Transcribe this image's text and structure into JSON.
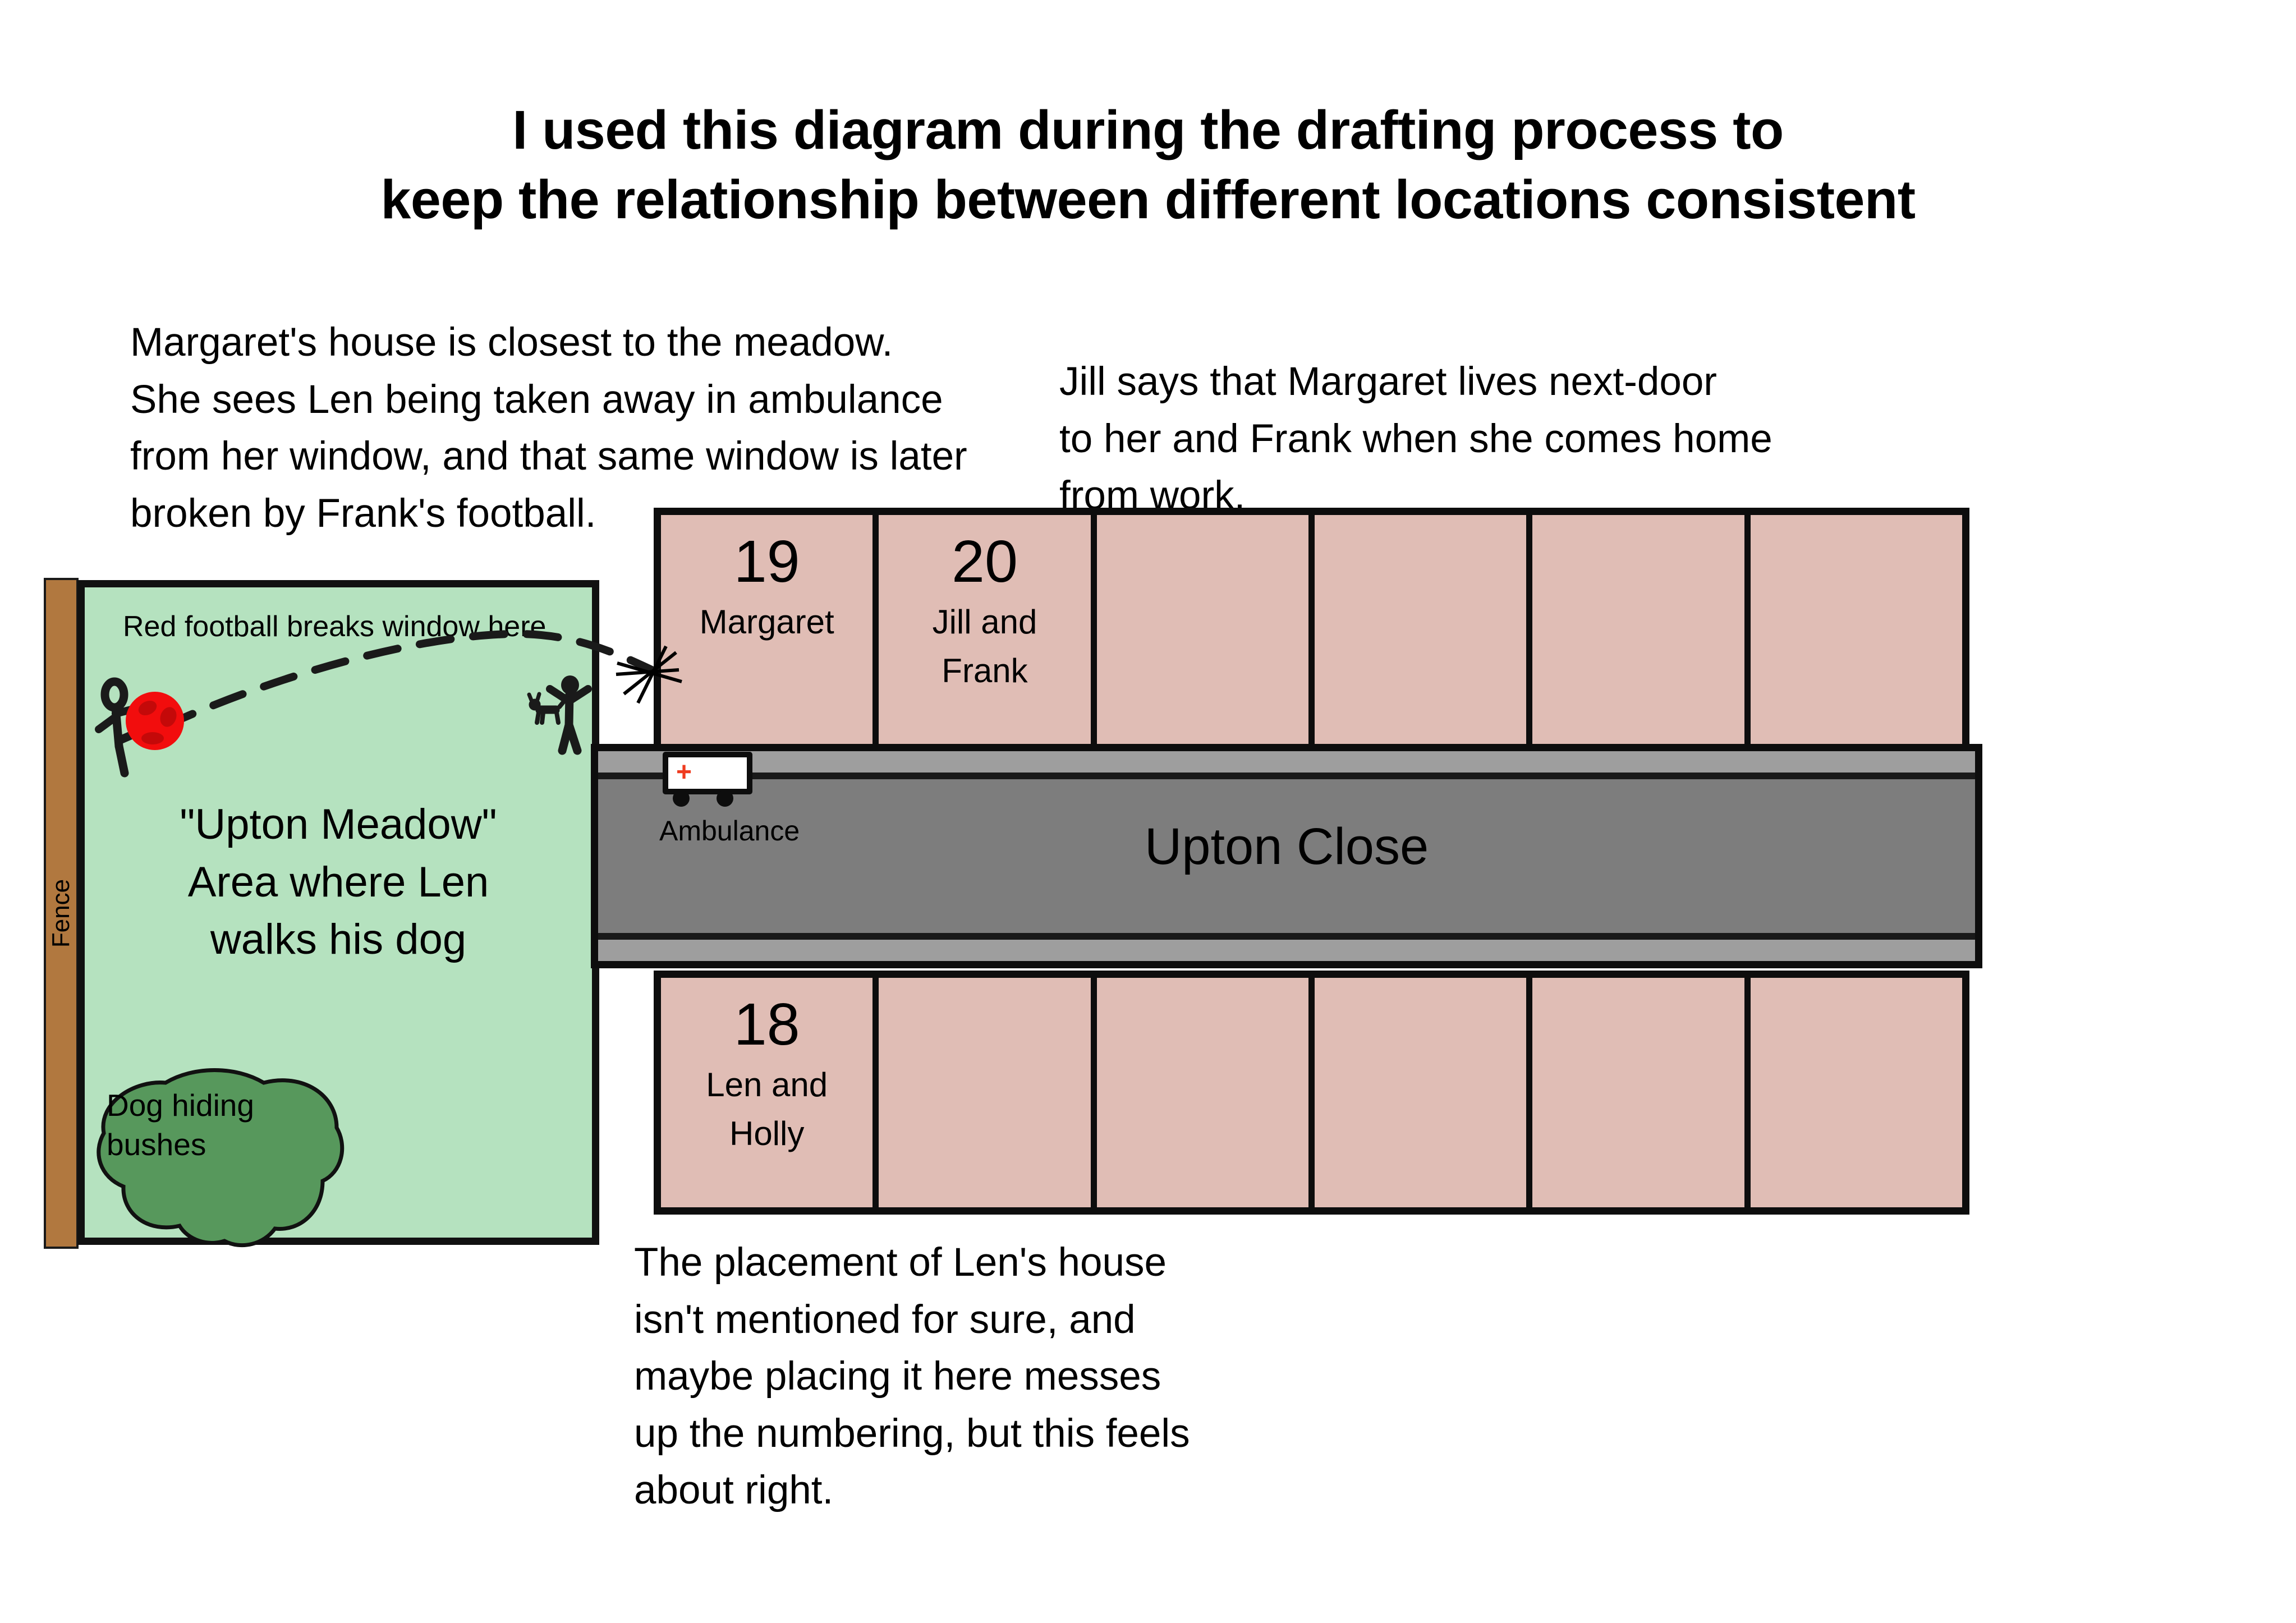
{
  "title": {
    "line1": "I used this diagram during the drafting process to",
    "line2": "keep the relationship between different locations consistent"
  },
  "annotations": {
    "margaret": "Margaret's house is closest to the meadow.\nShe sees Len being taken away in ambulance\nfrom her window, and that same window is later\nbroken by Frank's football.",
    "jill": "Jill says that Margaret lives next-door\nto her and Frank when she comes home\nfrom work.",
    "len_placement": "The placement of Len's house\nisn't mentioned for sure, and\nmaybe placing it here messes\nup the numbering, but this feels\nabout right."
  },
  "meadow": {
    "fence_label": "Fence",
    "football_note": "Red football breaks window here",
    "title_line1": "\"Upton Meadow\"",
    "title_line2": "Area where Len",
    "title_line3": "walks his dog",
    "bush_label": "Dog hiding\nbushes",
    "colors": {
      "grass": "#b5e2bf",
      "bush": "#57985c",
      "fence": "#b1783f",
      "football": "#f20d0d",
      "outline": "#111111"
    }
  },
  "road": {
    "name": "Upton Close",
    "colors": {
      "tarmac": "#7d7d7d",
      "pavement": "#9e9e9e",
      "outline": "#0d0d0d"
    }
  },
  "ambulance": {
    "label": "Ambulance",
    "cross": "+",
    "colors": {
      "body": "#ffffff",
      "cross": "#ef3b1f"
    }
  },
  "houses": {
    "fill_color": "#e0bdb5",
    "outline_color": "#0d0d0d",
    "top_row": [
      {
        "number": "19",
        "occupants": "Margaret"
      },
      {
        "number": "20",
        "occupants": "Jill and\nFrank"
      },
      {
        "number": "",
        "occupants": ""
      },
      {
        "number": "",
        "occupants": ""
      },
      {
        "number": "",
        "occupants": ""
      },
      {
        "number": "",
        "occupants": ""
      }
    ],
    "bottom_row": [
      {
        "number": "18",
        "occupants": "Len and\nHolly"
      },
      {
        "number": "",
        "occupants": ""
      },
      {
        "number": "",
        "occupants": ""
      },
      {
        "number": "",
        "occupants": ""
      },
      {
        "number": "",
        "occupants": ""
      },
      {
        "number": "",
        "occupants": ""
      }
    ]
  },
  "icons": {
    "kicker": "stick-figure-kicking-icon",
    "walker": "stick-figure-walking-icon",
    "dog": "dog-icon",
    "football": "red-football-icon",
    "trajectory": "dashed-ball-trajectory-icon",
    "window_break": "broken-window-star-icon",
    "bushes": "bush-blob-icon"
  }
}
